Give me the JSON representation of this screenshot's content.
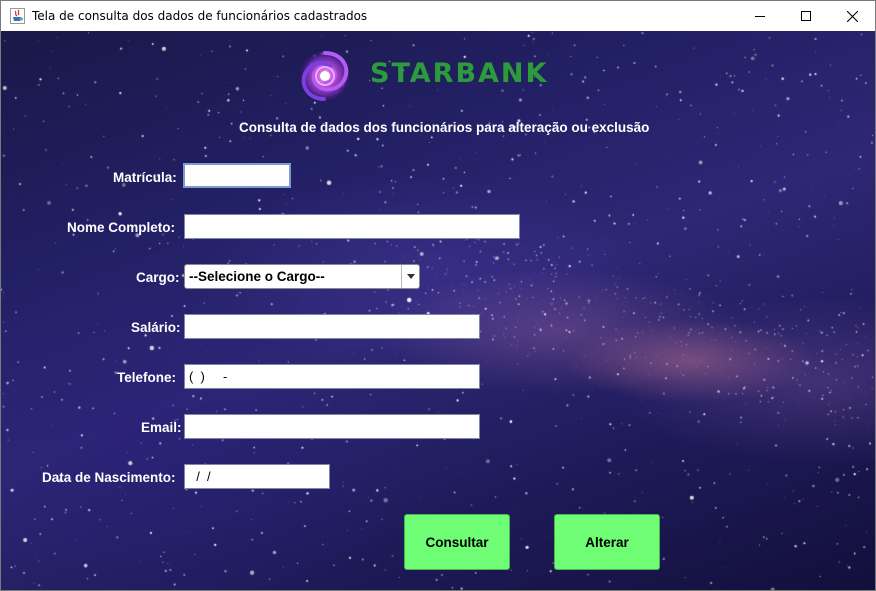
{
  "window": {
    "title": "Tela de consulta dos dados de funcionários cadastrados"
  },
  "brand": {
    "name": "STARBANK"
  },
  "form": {
    "heading": "Consulta de dados dos funcionários para alteração ou exclusão",
    "matricula": {
      "label": "Matrícula:",
      "value": ""
    },
    "nome": {
      "label": "Nome Completo:",
      "value": ""
    },
    "cargo": {
      "label": "Cargo:",
      "selected": "--Selecione o Cargo--"
    },
    "salario": {
      "label": "Salário:",
      "value": ""
    },
    "telefone": {
      "label": "Telefone:",
      "value": "(  )     -"
    },
    "email": {
      "label": "Email:",
      "value": ""
    },
    "nascimento": {
      "label": "Data de Nascimento:",
      "value": "  /  /"
    }
  },
  "buttons": {
    "consultar": "Consultar",
    "alterar": "Alterar"
  },
  "colors": {
    "button_bg": "#6efd74",
    "brand_green": "#2e9a3f",
    "background": "#232066"
  },
  "icons": {
    "app": "java-cup-icon",
    "minimize": "minimize-icon",
    "maximize": "maximize-icon",
    "close": "close-icon",
    "dropdown": "chevron-down-icon",
    "logo": "galaxy-logo"
  }
}
